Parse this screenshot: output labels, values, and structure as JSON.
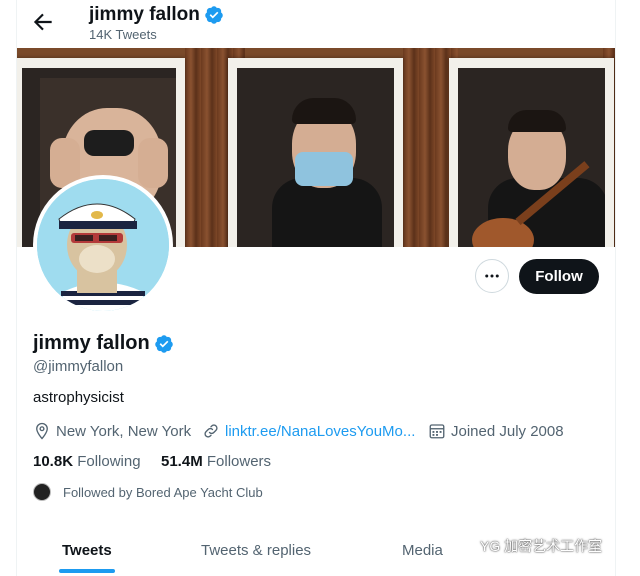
{
  "header": {
    "name": "jimmy fallon",
    "tweet_count": "14K Tweets"
  },
  "profile": {
    "name": "jimmy fallon",
    "handle": "@jimmyfallon",
    "bio": "astrophysicist",
    "location": "New York, New York",
    "website": "linktr.ee/NanaLovesYouMo...",
    "joined": "Joined July 2008",
    "following_count": "10.8K",
    "following_label": "Following",
    "followers_count": "51.4M",
    "followers_label": "Followers",
    "followed_by": "Followed by Bored Ape Yacht Club"
  },
  "actions": {
    "follow_label": "Follow"
  },
  "tabs": [
    {
      "label": "Tweets",
      "active": true
    },
    {
      "label": "Tweets & replies",
      "active": false
    },
    {
      "label": "Media",
      "active": false
    }
  ],
  "watermark": {
    "text": "YG 加密艺术工作室"
  },
  "colors": {
    "accent": "#1d9bf0",
    "text": "#0f1419",
    "muted": "#536471",
    "button": "#0f1419"
  }
}
